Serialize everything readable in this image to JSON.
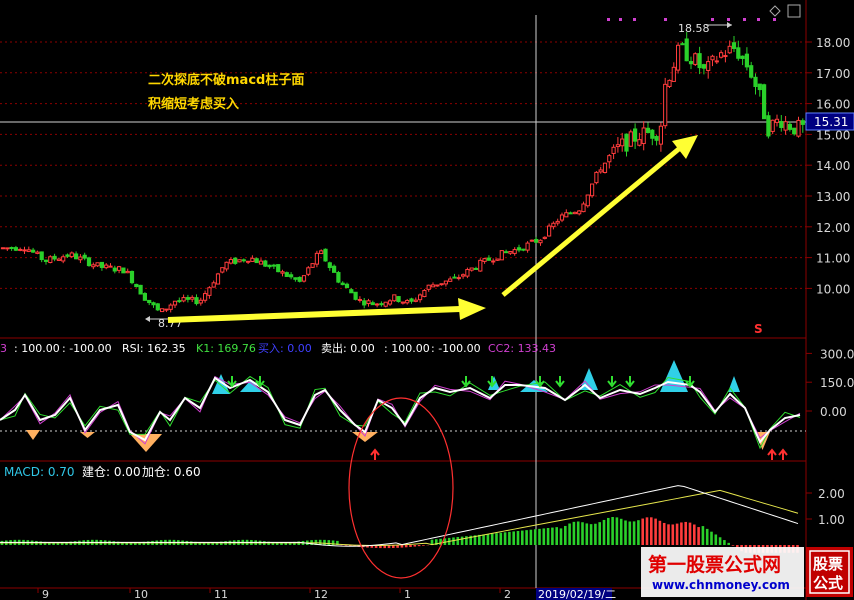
{
  "main_chart": {
    "annotation_line1": "二次探底不破macd柱子面",
    "annotation_line2": "积缩短考虑买入",
    "high_label": "18.58",
    "low_label": "8.77",
    "current_price": "15.31",
    "marker_s": "S",
    "y_ticks": [
      "18.00",
      "17.00",
      "16.00",
      "15.00",
      "14.00",
      "13.00",
      "12.00",
      "11.00",
      "10.00"
    ]
  },
  "indicator_panel": {
    "items": [
      {
        "text": "3",
        "color": "#d040d0"
      },
      {
        "text": ": 100.00",
        "color": "#ffffff"
      },
      {
        "text": ": -100.00",
        "color": "#ffffff"
      },
      {
        "text": "RSI: 162.35",
        "color": "#ffffff"
      },
      {
        "text": "K1: 169.76",
        "color": "#40e040"
      },
      {
        "text": "买入: 0.00",
        "color": "#4040ff"
      },
      {
        "text": "卖出: 0.00",
        "color": "#ffffff"
      },
      {
        "text": ": 100.00",
        "color": "#ffffff"
      },
      {
        "text": ": -100.00",
        "color": "#ffffff"
      },
      {
        "text": "CC2: 133.43",
        "color": "#d040d0"
      }
    ],
    "y_ticks": [
      "300.0",
      "150.0",
      "0.00"
    ]
  },
  "macd_panel": {
    "macd_label": "MACD: 0.70",
    "build_label": "建仓: 0.00",
    "add_label": "加仓: 0.60",
    "y_ticks": [
      "2.00",
      "1.00"
    ]
  },
  "time_axis": {
    "labels": [
      "9",
      "10",
      "11",
      "12",
      "1",
      "2"
    ],
    "cursor_date": "2019/02/19/二"
  },
  "watermark": {
    "line1": "第一股票公式网",
    "line2": "www.chnmoney.com",
    "badge_top": "股票",
    "badge_bottom": "公式"
  },
  "colors": {
    "up": "#ff3c3c",
    "down": "#2ad02a",
    "arrow": "#ffff33",
    "grid": "#8b0000",
    "axis_text": "#d8d8d8",
    "macd_diff": "#ffffff",
    "macd_dea": "#e6e64c",
    "cyan_fill": "#30d0e8",
    "pink_fill": "#ffb0ff",
    "orange_fill": "#ffb060"
  }
}
